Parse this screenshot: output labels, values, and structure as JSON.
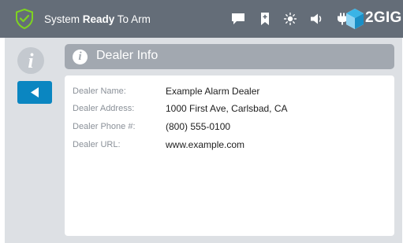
{
  "status_bar": {
    "status_prefix": "System ",
    "status_bold": "Ready",
    "status_suffix": " To Arm",
    "icons": [
      "message-icon",
      "bookmark-icon",
      "brightness-icon",
      "volume-icon",
      "power-plug-icon"
    ],
    "brand": "2GIG"
  },
  "sidebar": {
    "info_icon_glyph": "i"
  },
  "header": {
    "title": "Dealer Info",
    "icon_glyph": "i"
  },
  "dealer_info": {
    "rows": [
      {
        "label": "Dealer Name:",
        "value": "Example Alarm Dealer"
      },
      {
        "label": "Dealer Address:",
        "value": "1000 First Ave, Carlsbad, CA"
      },
      {
        "label": "Dealer Phone #:",
        "value": "(800) 555-0100"
      },
      {
        "label": "Dealer URL:",
        "value": "www.example.com"
      }
    ]
  },
  "colors": {
    "top_bar": "#646d78",
    "shield_accent": "#7ed321",
    "back_button": "#0a86c1",
    "title_bar": "#a2a8b0",
    "panel": "#dde0e4"
  }
}
